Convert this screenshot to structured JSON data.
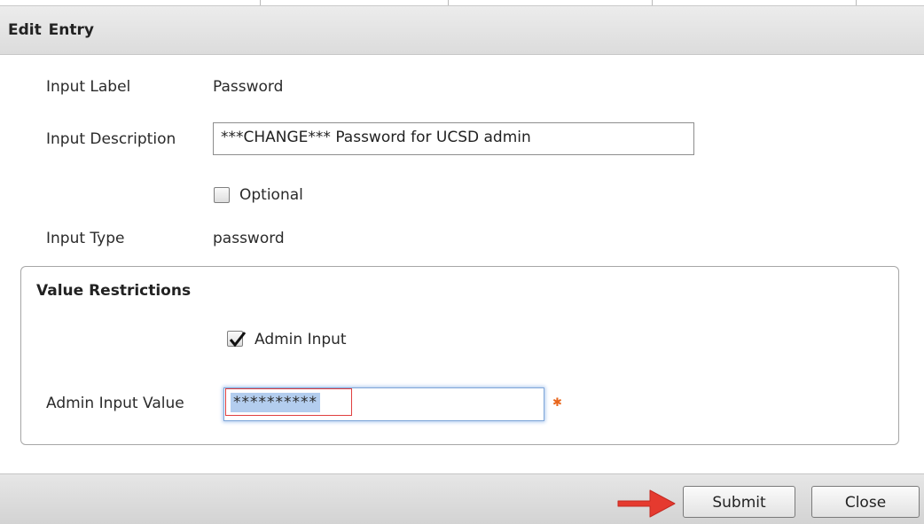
{
  "dialog": {
    "title": "Edit  Entry"
  },
  "form": {
    "input_label": {
      "label": "Input Label",
      "value": "Password"
    },
    "input_description": {
      "label": "Input Description",
      "value": "***CHANGE*** Password for UCSD admin"
    },
    "optional": {
      "label": "Optional",
      "checked": false
    },
    "input_type": {
      "label": "Input Type",
      "value": "password"
    }
  },
  "value_restrictions": {
    "title": "Value Restrictions",
    "admin_input": {
      "label": "Admin Input",
      "checked": true
    },
    "admin_input_value": {
      "label": "Admin Input Value",
      "value": "**********",
      "required_marker": "✱"
    }
  },
  "footer": {
    "submit_label": "Submit",
    "close_label": "Close"
  },
  "colors": {
    "required_marker": "#e8661c",
    "annotation_arrow": "#e53a2f",
    "annotation_box": "#e04040",
    "selection": "#b3cdee"
  },
  "icons": [
    "checkmark-icon",
    "required-asterisk-icon",
    "pointer-arrow-annotation"
  ]
}
